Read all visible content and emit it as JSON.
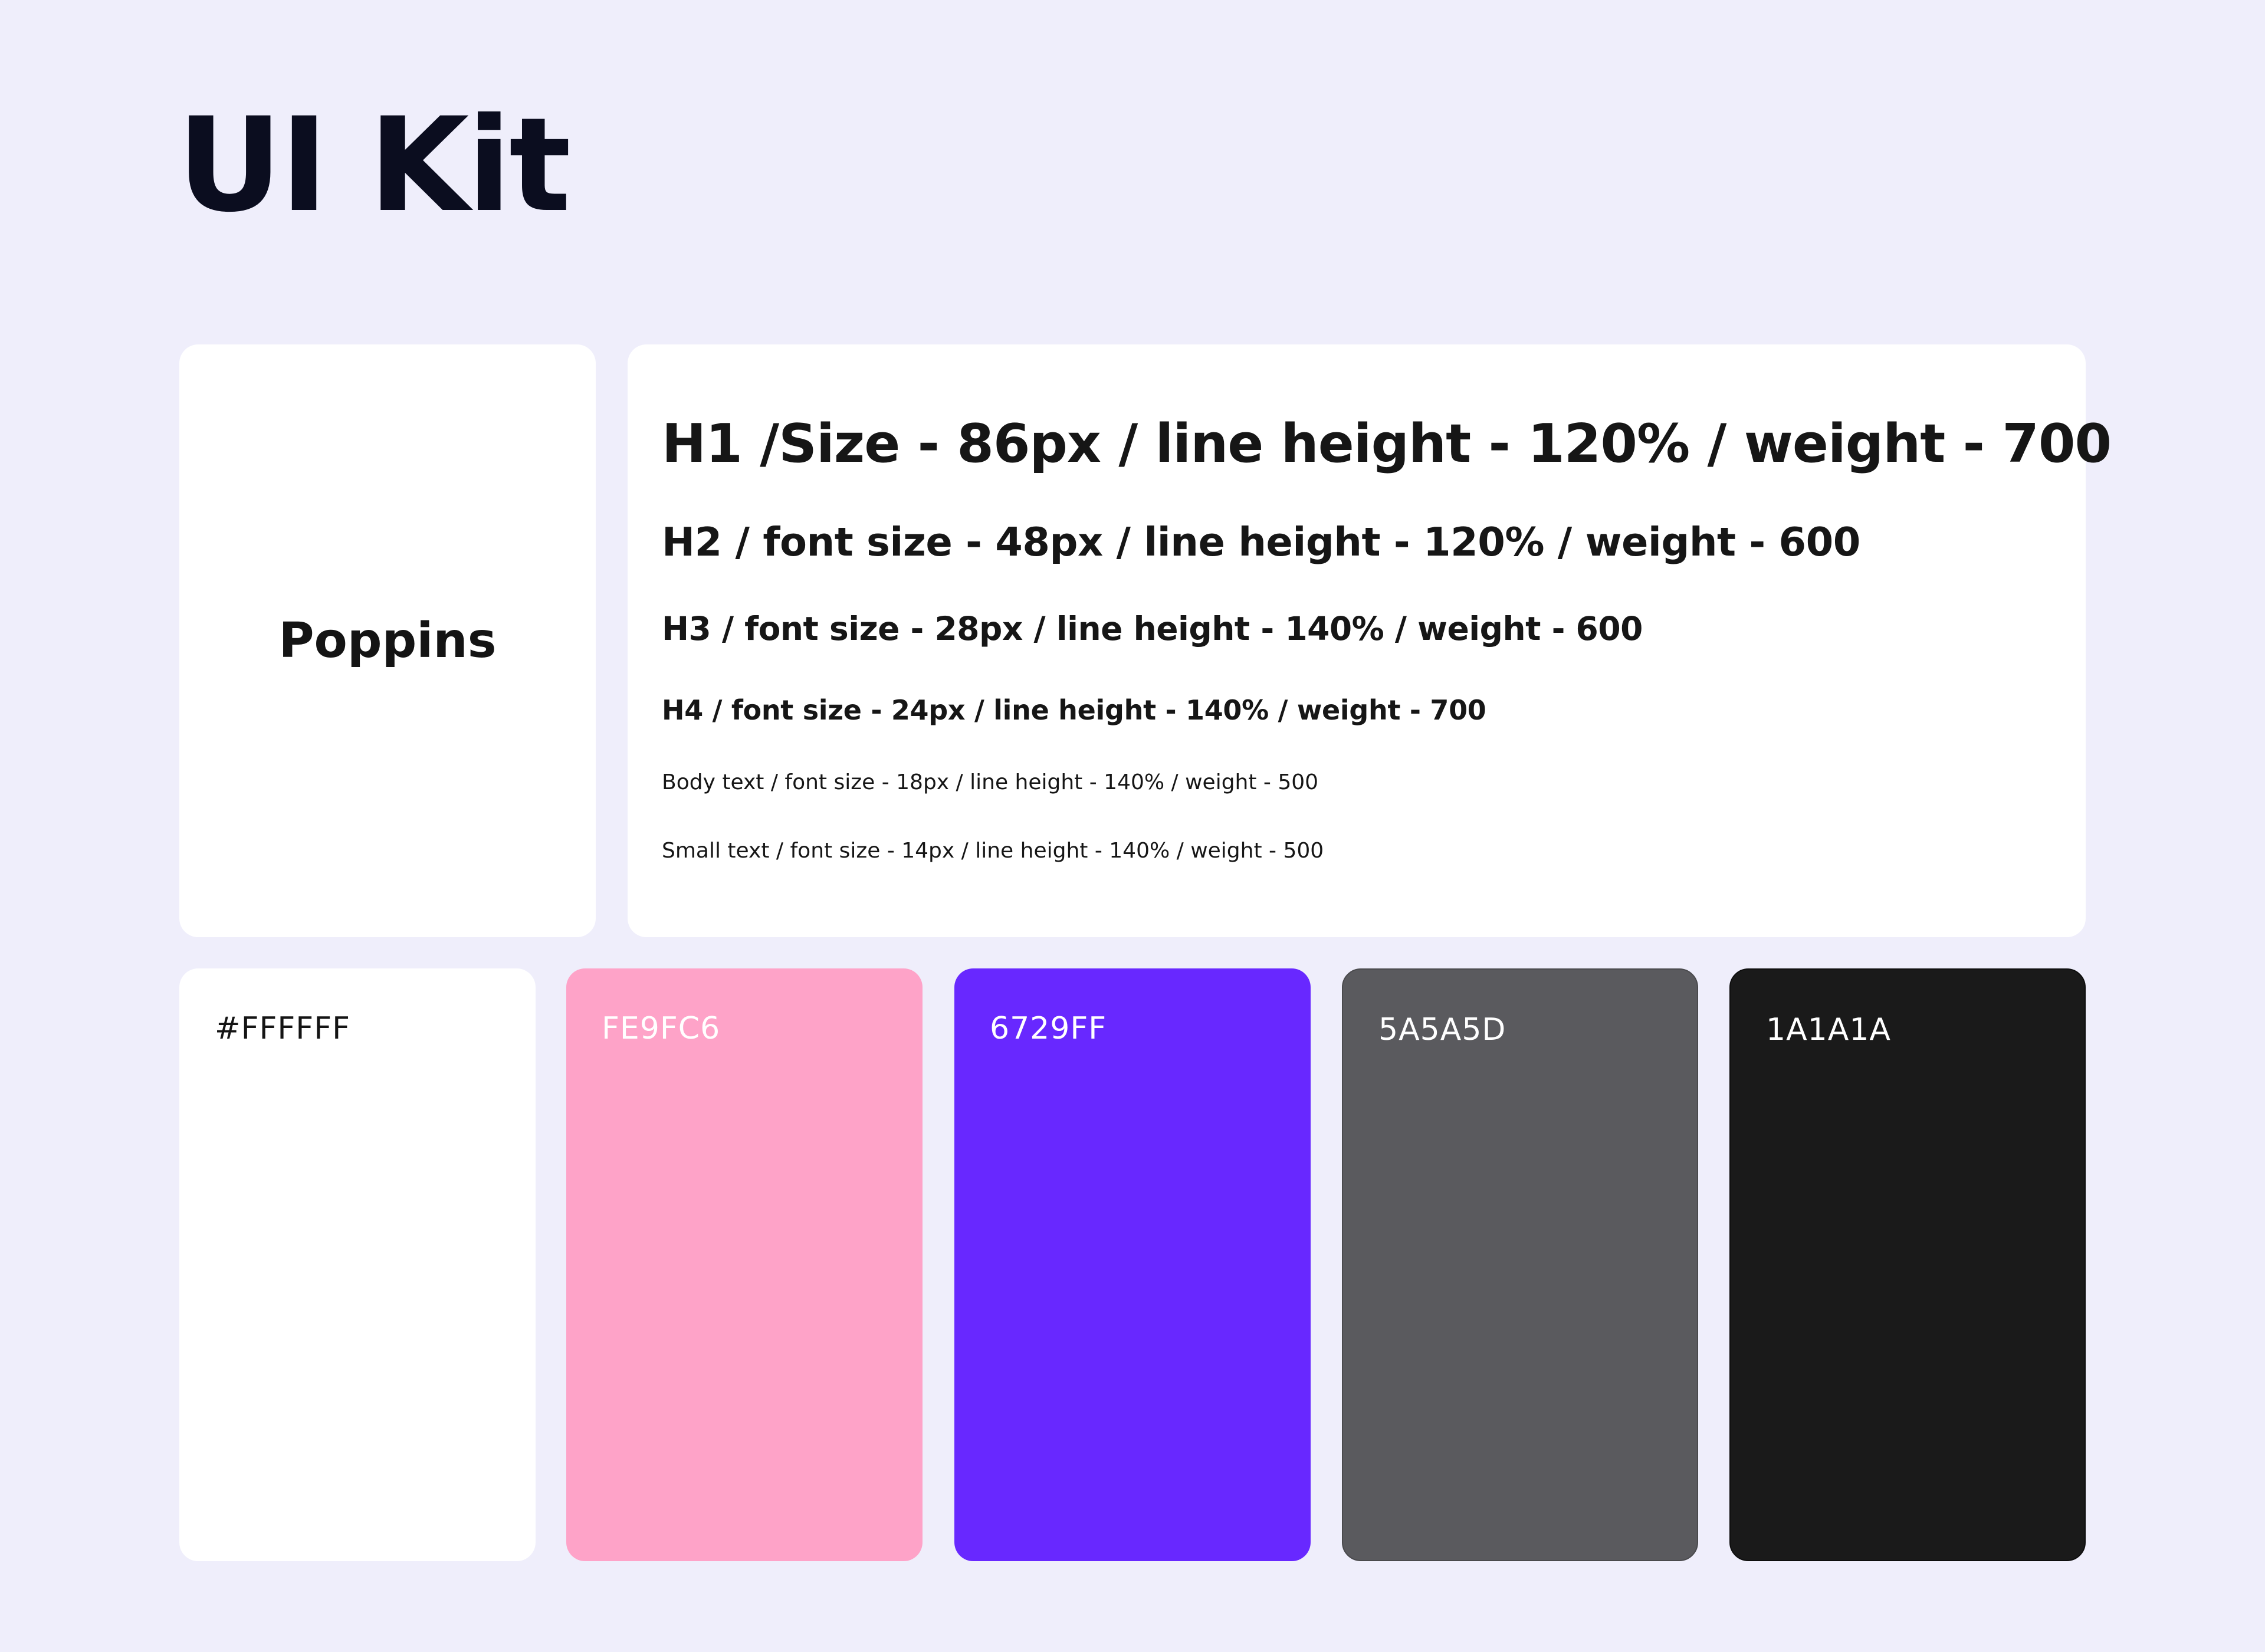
{
  "page": {
    "title": "UI Kit",
    "background": "#EFEEFB"
  },
  "typography": {
    "font_name": "Poppins",
    "styles": [
      {
        "id": "h1",
        "label": "H1 /Size - 86px / line height - 120% / weight - 700"
      },
      {
        "id": "h2",
        "label": "H2 / font size - 48px / line height - 120% / weight - 600"
      },
      {
        "id": "h3",
        "label": "H3 / font size - 28px / line height - 140% / weight - 600"
      },
      {
        "id": "h4",
        "label": "H4 / font size - 24px / line height - 140% / weight - 700"
      },
      {
        "id": "body",
        "label": "Body text / font size - 18px / line height - 140% / weight - 500"
      },
      {
        "id": "small",
        "label": "Small text / font size - 14px / line height - 140% / weight - 500"
      }
    ]
  },
  "palette": [
    {
      "label": "#FFFFFF",
      "color": "#FFFFFF",
      "text_color": "#141414"
    },
    {
      "label": "FE9FC6",
      "color": "#FEA3C8",
      "text_color": "#FFFFFF"
    },
    {
      "label": "6729FF",
      "color": "#6828FF",
      "text_color": "#FFFFFF"
    },
    {
      "label": "5A5A5D",
      "color": "#5A5A5E",
      "text_color": "#FFFFFF"
    },
    {
      "label": "1A1A1A",
      "color": "#1A1A1A",
      "text_color": "#FFFFFF"
    }
  ]
}
